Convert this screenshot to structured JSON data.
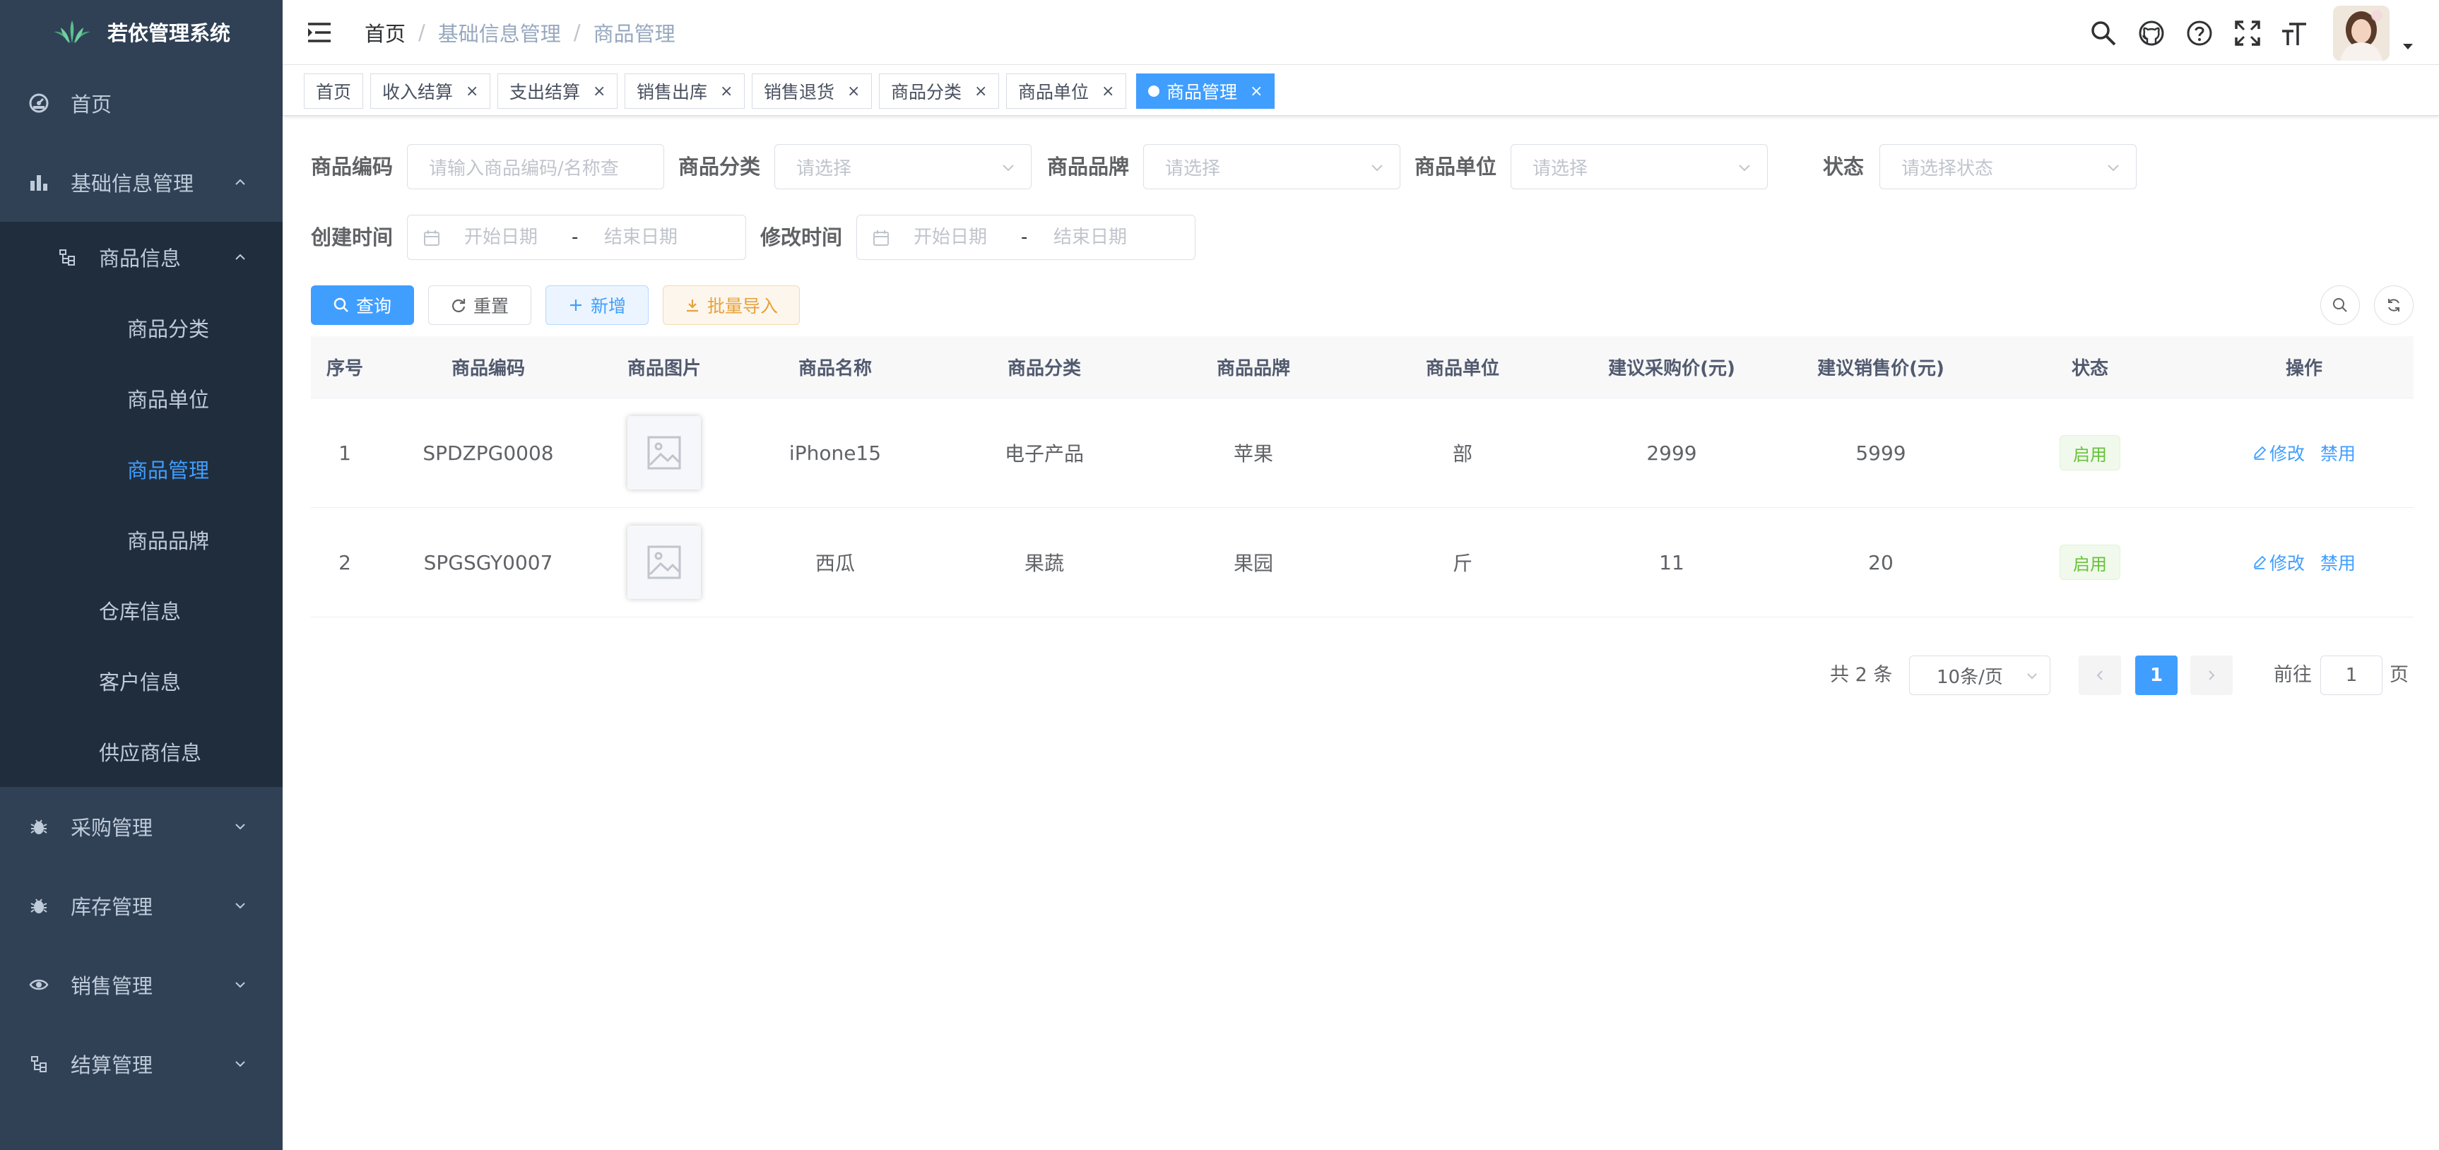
{
  "app": {
    "title": "若依管理系统"
  },
  "sidebar": {
    "home": "首页",
    "basic": "基础信息管理",
    "goods_info": "商品信息",
    "goods_sub": [
      "商品分类",
      "商品单位",
      "商品管理",
      "商品品牌"
    ],
    "basic_rest": [
      "仓库信息",
      "客户信息",
      "供应商信息"
    ],
    "bottom": [
      "采购管理",
      "库存管理",
      "销售管理",
      "结算管理"
    ]
  },
  "breadcrumb": {
    "home": "首页",
    "sep": "/",
    "level1": "基础信息管理",
    "level2": "商品管理"
  },
  "tags": [
    {
      "label": "首页"
    },
    {
      "label": "收入结算"
    },
    {
      "label": "支出结算"
    },
    {
      "label": "销售出库"
    },
    {
      "label": "销售退货"
    },
    {
      "label": "商品分类"
    },
    {
      "label": "商品单位"
    },
    {
      "label": "商品管理"
    }
  ],
  "tag_close": "×",
  "search": {
    "code_label": "商品编码",
    "code_placeholder": "请输入商品编码/名称查",
    "category_label": "商品分类",
    "category_placeholder": "请选择",
    "brand_label": "商品品牌",
    "brand_placeholder": "请选择",
    "unit_label": "商品单位",
    "unit_placeholder": "请选择",
    "status_label": "状态",
    "status_placeholder": "请选择状态",
    "created_label": "创建时间",
    "modified_label": "修改时间",
    "start_date": "开始日期",
    "date_sep": "-",
    "end_date": "结束日期"
  },
  "toolbar": {
    "query": "查询",
    "reset": "重置",
    "add": "新增",
    "import": "批量导入"
  },
  "table": {
    "headers": [
      "序号",
      "商品编码",
      "商品图片",
      "商品名称",
      "商品分类",
      "商品品牌",
      "商品单位",
      "建议采购价(元)",
      "建议销售价(元)",
      "状态",
      "操作"
    ],
    "rows": [
      {
        "index": "1",
        "code": "SPDZPG0008",
        "name": "iPhone15",
        "category": "电子产品",
        "brand": "苹果",
        "unit": "部",
        "purchase": "2999",
        "sale": "5999",
        "status": "启用"
      },
      {
        "index": "2",
        "code": "SPGSGY0007",
        "name": "西瓜",
        "category": "果蔬",
        "brand": "果园",
        "unit": "斤",
        "purchase": "11",
        "sale": "20",
        "status": "启用"
      }
    ],
    "edit": "修改",
    "disable": "禁用"
  },
  "pagination": {
    "total": "共 2 条",
    "size": "10条/页",
    "current": "1",
    "goto": "前往",
    "page_value": "1",
    "page_unit": "页"
  },
  "colors": {
    "sidebar_bg": "#304156",
    "submenu_bg": "#1f2d3d",
    "primary": "#409eff",
    "success": "#67c23a",
    "warning": "#e6a23c"
  }
}
